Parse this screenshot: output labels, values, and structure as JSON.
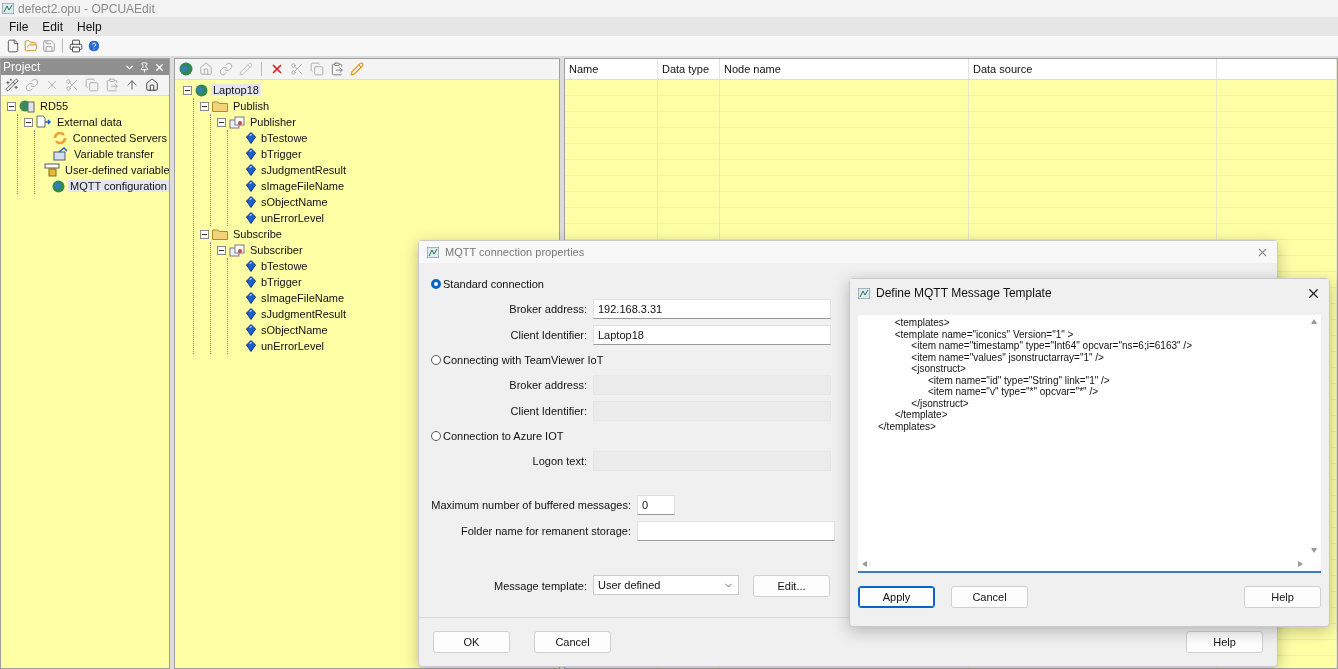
{
  "window": {
    "title": "defect2.opu - OPCUAEdit"
  },
  "menu": [
    "File",
    "Edit",
    "Help"
  ],
  "project_panel": {
    "title": "Project",
    "tree": [
      {
        "label": "RD55",
        "kind": "station",
        "selected": false,
        "children": [
          {
            "label": "External data",
            "kind": "external",
            "selected": false,
            "children": [
              {
                "label": "Connected Servers",
                "kind": "servers",
                "selected": false
              },
              {
                "label": "Variable transfer",
                "kind": "transfer",
                "selected": false
              },
              {
                "label": "User-defined variable",
                "kind": "userdef",
                "selected": false
              },
              {
                "label": "MQTT configuration",
                "kind": "globe",
                "selected": true
              }
            ]
          }
        ]
      }
    ]
  },
  "variables_tree": [
    {
      "label": "Laptop18",
      "kind": "globe",
      "selected": true,
      "children": [
        {
          "label": "Publish",
          "kind": "folder",
          "selected": false,
          "children": [
            {
              "label": "Publisher",
              "kind": "group",
              "selected": false,
              "children": [
                {
                  "label": "bTestowe",
                  "kind": "variable",
                  "selected": false
                },
                {
                  "label": "bTrigger",
                  "kind": "variable",
                  "selected": false
                },
                {
                  "label": "sJudgmentResult",
                  "kind": "variable",
                  "selected": false
                },
                {
                  "label": "sImageFileName",
                  "kind": "variable",
                  "selected": false
                },
                {
                  "label": "sObjectName",
                  "kind": "variable",
                  "selected": false
                },
                {
                  "label": "unErrorLevel",
                  "kind": "variable",
                  "selected": false
                }
              ]
            }
          ]
        },
        {
          "label": "Subscribe",
          "kind": "folder",
          "selected": false,
          "children": [
            {
              "label": "Subscriber",
              "kind": "group",
              "selected": false,
              "children": [
                {
                  "label": "bTestowe",
                  "kind": "variable",
                  "selected": false
                },
                {
                  "label": "bTrigger",
                  "kind": "variable",
                  "selected": false
                },
                {
                  "label": "sImageFileName",
                  "kind": "variable",
                  "selected": false
                },
                {
                  "label": "sJudgmentResult",
                  "kind": "variable",
                  "selected": false
                },
                {
                  "label": "sObjectName",
                  "kind": "variable",
                  "selected": false
                },
                {
                  "label": "unErrorLevel",
                  "kind": "variable",
                  "selected": false
                }
              ]
            }
          ]
        }
      ]
    }
  ],
  "table": {
    "columns": [
      "Name",
      "Data type",
      "Node name",
      "Data source"
    ]
  },
  "connection_dialog": {
    "title": "MQTT connection properties",
    "options": [
      {
        "label": "Standard connection",
        "selected": true,
        "fields": [
          {
            "label": "Broker address:",
            "value": "192.168.3.31",
            "disabled": false
          },
          {
            "label": "Client Identifier:",
            "value": "Laptop18",
            "disabled": false
          }
        ]
      },
      {
        "label": "Connecting with TeamViewer IoT",
        "selected": false,
        "fields": [
          {
            "label": "Broker address:",
            "disabled": true
          },
          {
            "label": "Client Identifier:",
            "disabled": true
          }
        ]
      },
      {
        "label": "Connection to Azure IOT",
        "selected": false,
        "fields": [
          {
            "label": "Logon text:",
            "disabled": true
          }
        ]
      }
    ],
    "buffered": {
      "label": "Maximum number of buffered messages:",
      "value": "0"
    },
    "folder": {
      "label": "Folder name for remanent storage:"
    },
    "template": {
      "label": "Message template:",
      "value": "User defined"
    },
    "edit_button": "Edit...",
    "buttons": [
      "OK",
      "Cancel",
      "Help"
    ]
  },
  "template_dialog": {
    "title": "Define MQTT Message Template",
    "text": "      <templates>\n      <template name=\"iconics\" Version=\"1\" >\n            <item name=\"timestamp\" type=\"Int64\" opcvar=\"ns=6;i=6163\" />\n            <item name=\"values\" jsonstructarray=\"1\" />\n            <jsonstruct>\n                  <item name=\"id\" type=\"String\" link=\"1\" />\n                  <item name=\"v\" type=\"*\" opcvar=\"*\" />\n            </jsonstruct>\n      </template>\n</templates>",
    "buttons": [
      {
        "label": "Apply",
        "focused": true
      },
      {
        "label": "Cancel",
        "focused": false
      },
      {
        "label": "Help",
        "focused": false
      }
    ]
  }
}
